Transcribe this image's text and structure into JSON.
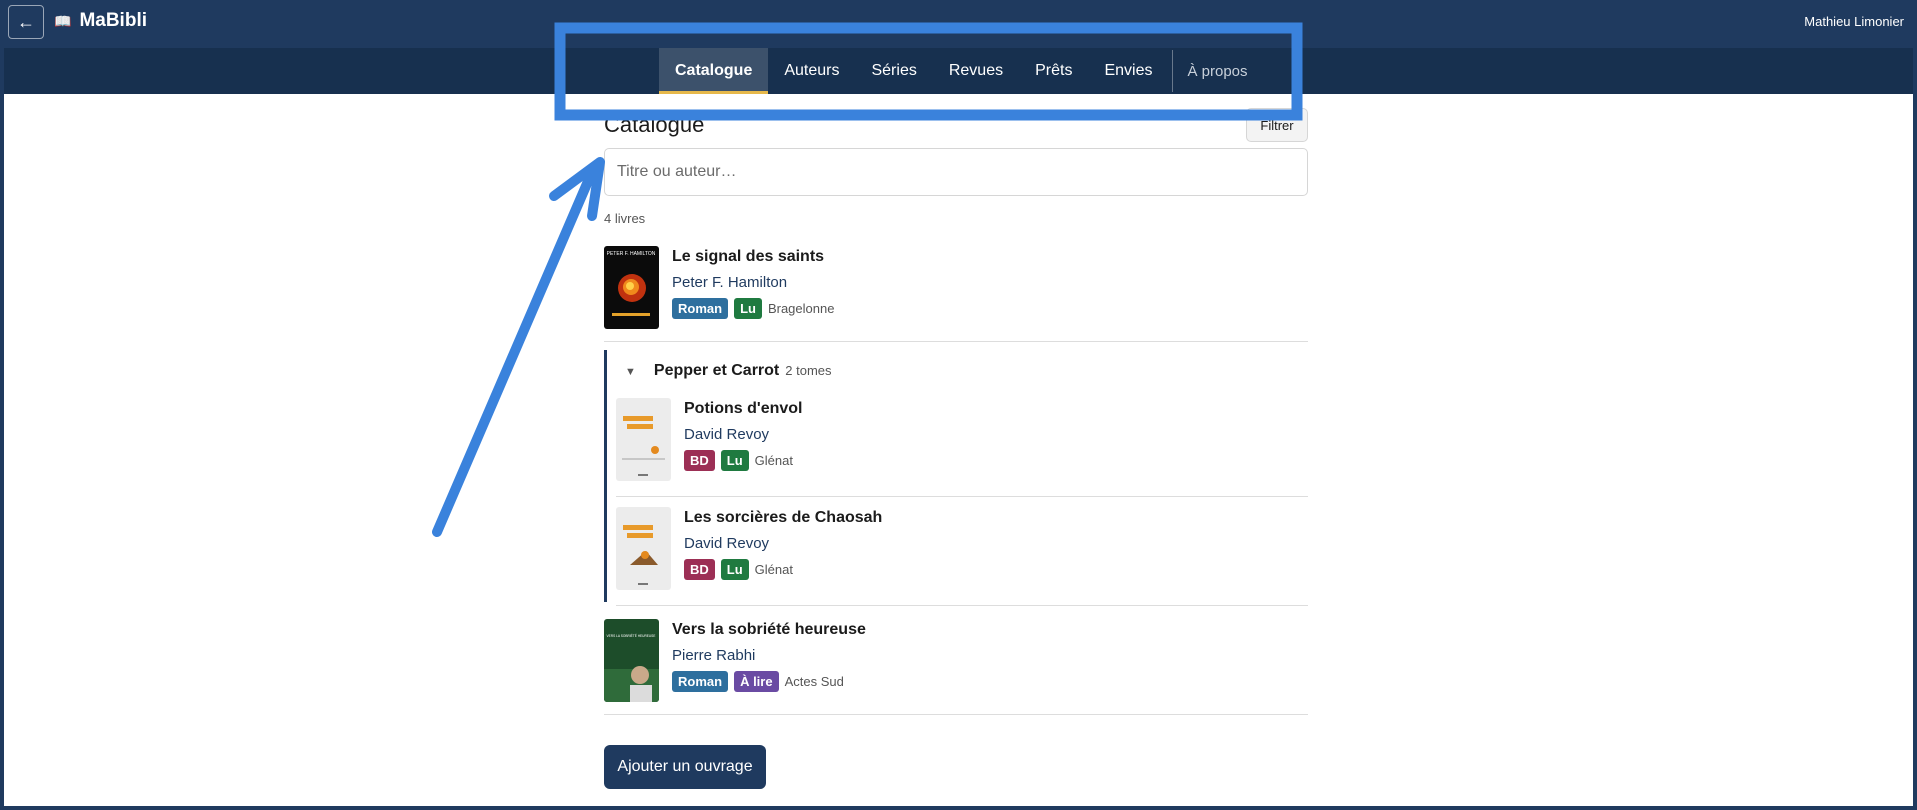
{
  "header": {
    "back_label": "←",
    "brand_icon": "📖",
    "brand": "MaBibli",
    "user": "Mathieu Limonier"
  },
  "nav": {
    "items": [
      {
        "label": "Catalogue",
        "active": true
      },
      {
        "label": "Auteurs"
      },
      {
        "label": "Séries"
      },
      {
        "label": "Revues"
      },
      {
        "label": "Prêts"
      },
      {
        "label": "Envies"
      }
    ],
    "about": "À propos"
  },
  "catalogue": {
    "title": "Catalogue",
    "filter_label": "Filtrer",
    "search_placeholder": "Titre ou auteur…",
    "count": "4 livres",
    "books": [
      {
        "title": "Le signal des saints",
        "author": "Peter F. Hamilton",
        "tags": [
          "Roman",
          "Lu"
        ],
        "publisher": "Bragelonne",
        "cover_text": "PETER F. HAMILTON"
      },
      {
        "title": "Vers la sobriété heureuse",
        "author": "Pierre Rabhi",
        "tags": [
          "Roman",
          "À lire"
        ],
        "publisher": "Actes Sud",
        "cover_text": "VERS LA SOBRIÉTÉ HEUREUSE"
      }
    ],
    "series": {
      "chevron": "▼",
      "name": "Pepper et Carrot",
      "count": "2 tomes",
      "books": [
        {
          "title": "Potions d'envol",
          "author": "David Revoy",
          "tags": [
            "BD",
            "Lu"
          ],
          "publisher": "Glénat"
        },
        {
          "title": "Les sorcières de Chaosah",
          "author": "David Revoy",
          "tags": [
            "BD",
            "Lu"
          ],
          "publisher": "Glénat"
        }
      ]
    },
    "add_label": "Ajouter un ouvrage"
  },
  "colors": {
    "header_bg": "#1f3a5f",
    "nav_bg": "#17304f",
    "annotation": "#3a82dc",
    "tag_roman": "#2e6f9e",
    "tag_bd": "#9c2f55",
    "tag_lu": "#1f7a40",
    "tag_alire": "#6a4ba3"
  }
}
